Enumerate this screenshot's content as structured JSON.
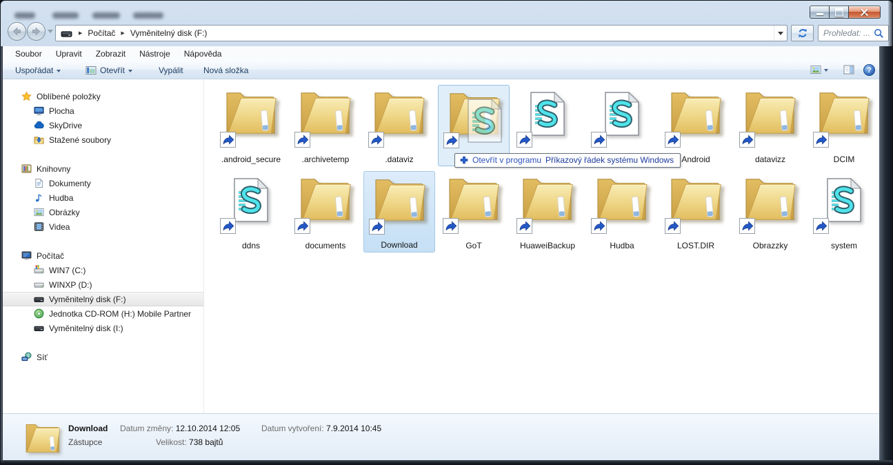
{
  "titlebar": {
    "minimize": "minimize",
    "maximize": "maximize",
    "close": "close"
  },
  "nav": {
    "breadcrumb": {
      "items": [
        "Počítač",
        "Vyměnitelný disk (F:)"
      ]
    },
    "search_placeholder": "Prohledat: ..."
  },
  "menu": {
    "items": [
      "Soubor",
      "Upravit",
      "Zobrazit",
      "Nástroje",
      "Nápověda"
    ]
  },
  "toolbar": {
    "organize": "Uspořádat",
    "open": "Otevřít",
    "burn": "Vypálit",
    "new_folder": "Nová složka"
  },
  "sidebar": {
    "rows": [
      {
        "icon": "star-icon",
        "label": "Oblíbené položky",
        "level": 1,
        "gap": false,
        "selected": false
      },
      {
        "icon": "desktop-icon",
        "label": "Plocha",
        "level": 2,
        "gap": false,
        "selected": false
      },
      {
        "icon": "skydrive-icon",
        "label": "SkyDrive",
        "level": 2,
        "gap": false,
        "selected": false
      },
      {
        "icon": "downloads-icon",
        "label": "Stažené soubory",
        "level": 2,
        "gap": false,
        "selected": false
      },
      {
        "icon": "libraries-icon",
        "label": "Knihovny",
        "level": 1,
        "gap": true,
        "selected": false
      },
      {
        "icon": "document-icon",
        "label": "Dokumenty",
        "level": 2,
        "gap": false,
        "selected": false
      },
      {
        "icon": "music-icon",
        "label": "Hudba",
        "level": 2,
        "gap": false,
        "selected": false
      },
      {
        "icon": "pictures-icon",
        "label": "Obrázky",
        "level": 2,
        "gap": false,
        "selected": false
      },
      {
        "icon": "videos-icon",
        "label": "Videa",
        "level": 2,
        "gap": false,
        "selected": false
      },
      {
        "icon": "computer-icon",
        "label": "Počítač",
        "level": 1,
        "gap": true,
        "selected": false
      },
      {
        "icon": "windows-drive-icon",
        "label": "WIN7 (C:)",
        "level": 2,
        "gap": false,
        "selected": false
      },
      {
        "icon": "drive-icon",
        "label": "WINXP (D:)",
        "level": 2,
        "gap": false,
        "selected": false
      },
      {
        "icon": "removable-drive-icon",
        "label": "Vyměnitelný disk (F:)",
        "level": 2,
        "gap": false,
        "selected": true
      },
      {
        "icon": "cdrom-icon",
        "label": "Jednotka CD-ROM (H:) Mobile Partner",
        "level": 2,
        "gap": false,
        "selected": false
      },
      {
        "icon": "removable-drive-icon",
        "label": "Vyměnitelný disk (I:)",
        "level": 2,
        "gap": false,
        "selected": false
      },
      {
        "icon": "network-icon",
        "label": "Síť",
        "level": 1,
        "gap": true,
        "selected": false
      }
    ]
  },
  "files": {
    "row1": [
      {
        "name": ".android_secure",
        "icon": "folder",
        "state": "normal"
      },
      {
        "name": ".archivetemp",
        "icon": "folder",
        "state": "normal"
      },
      {
        "name": ".dataviz",
        "icon": "folder",
        "state": "normal"
      },
      {
        "name": "",
        "icon": "folder",
        "state": "drop-target"
      },
      {
        "name": "",
        "icon": "script",
        "state": "normal"
      },
      {
        "name": "",
        "icon": "script",
        "state": "normal"
      },
      {
        "name": "Android",
        "icon": "folder",
        "state": "normal"
      },
      {
        "name": "datavizz",
        "icon": "folder",
        "state": "normal"
      },
      {
        "name": "DCIM",
        "icon": "folder",
        "state": "normal"
      }
    ],
    "row2": [
      {
        "name": "ddns",
        "icon": "script",
        "state": "normal"
      },
      {
        "name": "documents",
        "icon": "folder",
        "state": "normal"
      },
      {
        "name": "Download",
        "icon": "folder",
        "state": "selected"
      },
      {
        "name": "GoT",
        "icon": "folder",
        "state": "normal"
      },
      {
        "name": "HuaweiBackup",
        "icon": "folder",
        "state": "normal"
      },
      {
        "name": "Hudba",
        "icon": "folder",
        "state": "normal"
      },
      {
        "name": "LOST.DIR",
        "icon": "folder",
        "state": "normal"
      },
      {
        "name": "Obrazzky",
        "icon": "folder",
        "state": "normal"
      },
      {
        "name": "system",
        "icon": "script",
        "state": "normal"
      }
    ]
  },
  "drag": {
    "tooltip_action": "Otevřít v programu",
    "tooltip_target": "Příkazový řádek systému Windows"
  },
  "details": {
    "name": "Download",
    "type": "Zástupce",
    "modified_label": "Datum změny:",
    "modified_value": "12.10.2014 12:05",
    "created_label": "Datum vytvoření:",
    "created_value": "7.9.2014 10:45",
    "size_label": "Velikost:",
    "size_value": "738 bajtů"
  },
  "colors": {
    "selection_fill": "#cde4f8",
    "selection_border": "#a6c8e6",
    "drop_fill": "rgba(199,224,246,0.55)",
    "drop_border": "#95bfe5",
    "tooltip_action_color": "#2f52bd",
    "tooltip_target_color": "#1c3a9e",
    "folder_yellow": "#f0d98c",
    "script_cyan": "#4fe3ea",
    "close_button_red": "#cc613d"
  }
}
